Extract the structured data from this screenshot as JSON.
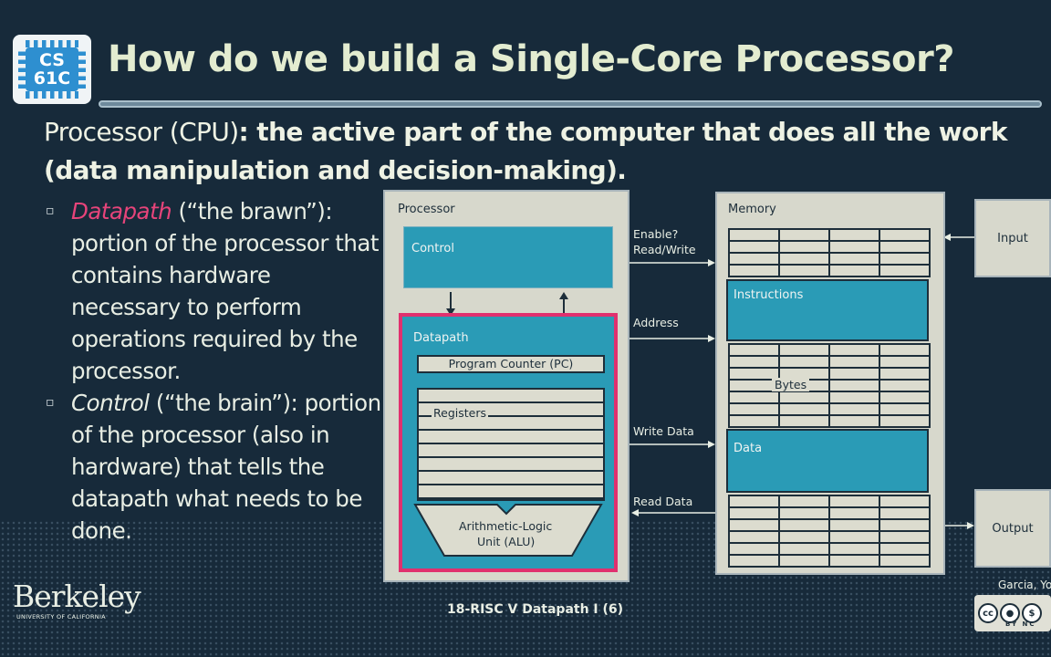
{
  "logo": {
    "line1": "CS",
    "line2": "61C"
  },
  "title": "How do we build a Single-Core Processor?",
  "intro": {
    "lead": "Processor (CPU)",
    "colon": ": ",
    "rest": "the active part of the computer that does all the work (data manipulation and decision-making)."
  },
  "bullets": [
    {
      "term": "Datapath",
      "rest": " (“the brawn”): portion of the processor that contains hardware necessary to perform operations required by the processor."
    },
    {
      "term": "Control",
      "rest": " (“the brain”): portion of the processor (also in hardware) that tells the datapath what needs to be done."
    }
  ],
  "diagram": {
    "processor": "Processor",
    "control": "Control",
    "datapath": "Datapath",
    "pc": "Program Counter (PC)",
    "registers": "Registers",
    "alu_line1": "Arithmetic-Logic",
    "alu_line2": "Unit (ALU)",
    "memory": "Memory",
    "instructions": "Instructions",
    "bytes": "Bytes",
    "data": "Data",
    "input": "Input",
    "output": "Output",
    "enable_line1": "Enable?",
    "enable_line2": "Read/Write",
    "address": "Address",
    "write_data": "Write Data",
    "read_data": "Read Data"
  },
  "footer": {
    "university": "Berkeley",
    "university_sub": "UNIVERSITY OF CALIFORNIA",
    "lecture": "18-RISC V Datapath I (6)",
    "author": "Garcia, Yo",
    "cc_labels": "BY NC"
  },
  "colors": {
    "background": "#172a3a",
    "teal": "#2a9bb6",
    "magenta": "#e0306e",
    "panel": "#d7d8cc"
  }
}
